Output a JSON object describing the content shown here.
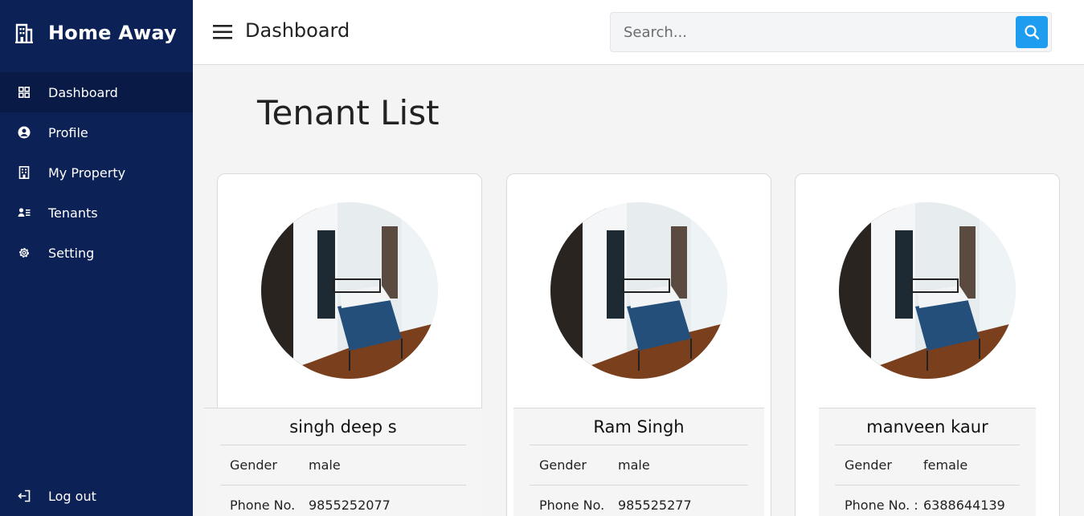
{
  "brand": {
    "name": "Home Away"
  },
  "sidebar": {
    "items": [
      {
        "label": "Dashboard",
        "icon": "grid-icon",
        "active": true
      },
      {
        "label": "Profile",
        "icon": "user-circle-icon"
      },
      {
        "label": "My Property",
        "icon": "building-icon"
      },
      {
        "label": "Tenants",
        "icon": "id-card-icon"
      },
      {
        "label": "Setting",
        "icon": "gear-icon"
      }
    ],
    "logout_label": "Log out"
  },
  "header": {
    "title": "Dashboard",
    "search_placeholder": "Search..."
  },
  "main": {
    "title": "Tenant List",
    "tenants": [
      {
        "name": "singh deep s",
        "gender_label": "Gender",
        "gender": "male",
        "phone_label": "Phone No.",
        "phone": "9855252077"
      },
      {
        "name": "Ram Singh",
        "gender_label": "Gender",
        "gender": "male",
        "phone_label": "Phone No.",
        "phone": "985525277"
      },
      {
        "name": "manveen kaur",
        "gender_label": "Gender",
        "gender": "female",
        "phone_label": "Phone No. :",
        "phone": "6388644139"
      }
    ]
  },
  "colors": {
    "sidebar_bg": "#0c2155",
    "sidebar_active": "#081a45",
    "accent": "#1e9cf0",
    "page_bg": "#f4f4f4"
  }
}
